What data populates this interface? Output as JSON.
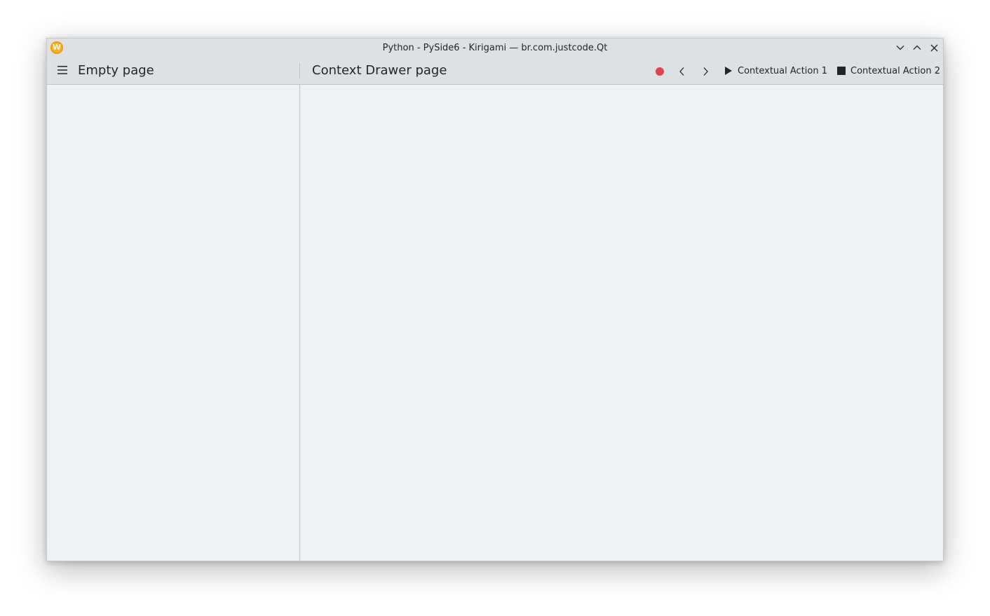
{
  "window": {
    "title": "Python - PySide6 - Kirigami — br.com.justcode.Qt",
    "app_icon_letter": "W",
    "controls": [
      "minimize-icon",
      "maximize-icon",
      "close-icon"
    ]
  },
  "global_drawer": {
    "menu_icon": "hamburger-icon",
    "page_title": "Empty page"
  },
  "context_page": {
    "title": "Context Drawer page",
    "actions": [
      {
        "icon": "record-icon",
        "label": ""
      },
      {
        "icon": "chevron-left-icon",
        "label": ""
      },
      {
        "icon": "chevron-right-icon",
        "label": ""
      },
      {
        "icon": "play-icon",
        "label": "Contextual Action 1"
      },
      {
        "icon": "stop-icon",
        "label": "Contextual Action 2"
      }
    ]
  },
  "colors": {
    "record": "#da4453",
    "text": "#232629",
    "header_bg": "#dee0e2",
    "content_bg": "#eff0f1",
    "divider": "#bfc2c5",
    "app_icon": "#f2b428"
  }
}
